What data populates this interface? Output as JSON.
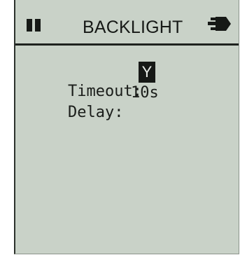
{
  "header": {
    "title": "BACKLIGHT",
    "left_icon": "pause-icon",
    "right_icon": "plug-icon"
  },
  "settings": [
    {
      "label": "Timeout:",
      "value": "Y",
      "selected": true
    },
    {
      "label": "Delay:",
      "value": "10s",
      "selected": false
    }
  ],
  "colors": {
    "screen_background": "#c9d2c8",
    "text": "#161916",
    "highlight_background": "#161916",
    "highlight_text": "#e9ede8"
  }
}
